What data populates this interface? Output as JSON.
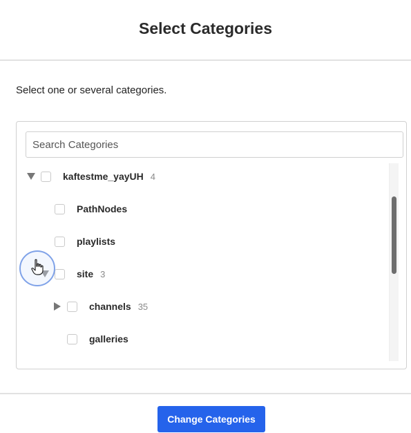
{
  "dialog": {
    "title": "Select Categories",
    "instructions": "Select one or several categories."
  },
  "search": {
    "placeholder": "Search Categories",
    "value": ""
  },
  "tree": [
    {
      "label": "kaftestme_yayUH",
      "count": "4",
      "caret": "expanded",
      "checked": false
    },
    {
      "label": "PathNodes",
      "count": "",
      "caret": "none",
      "checked": false
    },
    {
      "label": "playlists",
      "count": "",
      "caret": "none",
      "checked": false
    },
    {
      "label": "site",
      "count": "3",
      "caret": "expanded",
      "checked": false
    },
    {
      "label": "channels",
      "count": "35",
      "caret": "collapsed",
      "checked": false
    },
    {
      "label": "galleries",
      "count": "",
      "caret": "none",
      "checked": false
    }
  ],
  "actions": {
    "submit_label": "Change Categories"
  },
  "colors": {
    "primary": "#2563eb",
    "cursor_highlight": "#7fa2e8"
  },
  "icons": {
    "expanded": "caret-down-icon",
    "collapsed": "caret-right-icon",
    "pointer": "hand-pointer-icon"
  }
}
